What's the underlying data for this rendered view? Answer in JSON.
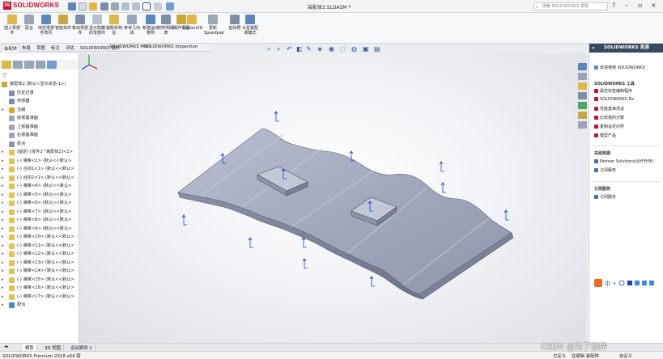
{
  "app": {
    "logo_text": "SOLIDWORKS",
    "document_title": "装配体2.SLDASM *",
    "search_placeholder": "搜索 SOLIDWORKS 帮助"
  },
  "ribbon": {
    "buttons": [
      {
        "label": "插入零部件",
        "icon": "insert-component-icon"
      },
      {
        "label": "配合",
        "icon": "mate-icon"
      },
      {
        "label": "线性零部件阵列",
        "icon": "linear-pattern-icon"
      },
      {
        "label": "智能扣件",
        "icon": "smart-fastener-icon"
      },
      {
        "label": "移动零部件",
        "icon": "move-component-icon"
      },
      {
        "label": "显示隐藏的零部件",
        "icon": "show-hidden-icon"
      },
      {
        "label": "装配体特征",
        "icon": "assembly-feature-icon"
      },
      {
        "label": "参考几何体",
        "icon": "reference-geometry-icon"
      },
      {
        "label": "新建运动算例",
        "icon": "motion-study-icon"
      },
      {
        "label": "材料明细表",
        "icon": "bom-icon"
      },
      {
        "label": "爆炸视图",
        "icon": "exploded-view-icon"
      },
      {
        "label": "Instant3D",
        "icon": "instant3d-icon"
      },
      {
        "label": "更新Speedpak",
        "icon": "speedpak-icon"
      },
      {
        "label": "拍快照",
        "icon": "snapshot-icon"
      },
      {
        "label": "大型装配体模式",
        "icon": "large-assembly-icon"
      }
    ]
  },
  "command_tabs": [
    "装配体",
    "布局",
    "草图",
    "标注",
    "评估",
    "SOLIDWORKS 插件",
    "SOLIDWORKS MBD",
    "SOLIDWORKS Inspection"
  ],
  "feature_tree": {
    "items": [
      {
        "label": "装配体2 (默认<显示状态-1>)",
        "icon_color": "#c8a640",
        "arrow": ""
      },
      {
        "label": "历史记录",
        "icon_color": "#7d8fa8",
        "arrow": ""
      },
      {
        "label": "传感器",
        "icon_color": "#7d8fa8",
        "arrow": ""
      },
      {
        "label": "注解",
        "icon_color": "#e0a020",
        "arrow": "▸"
      },
      {
        "label": "前视基准面",
        "icon_color": "#9aa6b8",
        "arrow": ""
      },
      {
        "label": "上视基准面",
        "icon_color": "#9aa6b8",
        "arrow": ""
      },
      {
        "label": "右视基准面",
        "icon_color": "#9aa6b8",
        "arrow": ""
      },
      {
        "label": "原点",
        "icon_color": "#8a96a8",
        "arrow": ""
      },
      {
        "label": "(固定) [零件1^装配体2]<1>",
        "icon_color": "#e4c34a",
        "arrow": "▸"
      },
      {
        "label": "(-) 弹簧<1> (默认<<默认>",
        "icon_color": "#e4c34a",
        "arrow": "▸"
      },
      {
        "label": "(-) 合扣1<1> (默认<<默认>",
        "icon_color": "#e4c34a",
        "arrow": "▸"
      },
      {
        "label": "(-) 合扣2<1> (默认<<默认>",
        "icon_color": "#e4c34a",
        "arrow": "▸"
      },
      {
        "label": "(-) 弹簧<4> (默认<<默认>",
        "icon_color": "#e4c34a",
        "arrow": "▸"
      },
      {
        "label": "(-) 弹簧<5> (默认<<默认>",
        "icon_color": "#e4c34a",
        "arrow": "▸"
      },
      {
        "label": "(-) 弹簧<6> (默认<<默认>",
        "icon_color": "#e4c34a",
        "arrow": "▸"
      },
      {
        "label": "(-) 弹簧<7> (默认<<默认>",
        "icon_color": "#e4c34a",
        "arrow": "▸"
      },
      {
        "label": "(-) 弹簧<8> (默认<<默认>",
        "icon_color": "#e4c34a",
        "arrow": "▸"
      },
      {
        "label": "(-) 弹簧<9> (默认<<默认>",
        "icon_color": "#e4c34a",
        "arrow": "▸"
      },
      {
        "label": "(-) 弹簧<10> (默认<<默认>",
        "icon_color": "#e4c34a",
        "arrow": "▸"
      },
      {
        "label": "(-) 弹簧<11> (默认<<默认>",
        "icon_color": "#e4c34a",
        "arrow": "▸"
      },
      {
        "label": "(-) 弹簧<12> (默认<<默认>",
        "icon_color": "#e4c34a",
        "arrow": "▸"
      },
      {
        "label": "(-) 弹簧<13> (默认<<默认>",
        "icon_color": "#e4c34a",
        "arrow": "▸"
      },
      {
        "label": "(-) 弹簧<14> (默认<<默认>",
        "icon_color": "#e4c34a",
        "arrow": "▸"
      },
      {
        "label": "(-) 弹簧<15> (默认<<默认>",
        "icon_color": "#e4c34a",
        "arrow": "▸"
      },
      {
        "label": "(-) 弹簧<16> (默认<<默认>",
        "icon_color": "#e4c34a",
        "arrow": "▸"
      },
      {
        "label": "(-) 弹簧<17> (默认<<默认>",
        "icon_color": "#e4c34a",
        "arrow": "▸"
      },
      {
        "label": "配合",
        "icon_color": "#4a8ac8",
        "arrow": "▸"
      }
    ]
  },
  "task_pane": {
    "title": "SOLIDWORKS 资源",
    "welcome": "欢迎使用 SOLIDWORKS",
    "tools_header": "SOLIDWORKS 工具",
    "tools": [
      {
        "label": "属性标签编制程序",
        "color": "#c8102e"
      },
      {
        "label": "SOLIDWORKS Rx",
        "color": "#c8102e"
      },
      {
        "label": "性能基准测试",
        "color": "#c8102e"
      },
      {
        "label": "比较我的分数",
        "color": "#c8102e"
      },
      {
        "label": "复制设定向导",
        "color": "#c8102e"
      },
      {
        "label": "模型产品",
        "color": "#c8102e"
      }
    ],
    "online_header": "在线资源",
    "online": [
      {
        "label": "Partner Solutions(合作伙伴)",
        "color": "#4a6ea8"
      },
      {
        "label": "订阅服务",
        "color": "#4a6ea8"
      }
    ],
    "sub_header": "订阅服务",
    "sub": [
      {
        "label": "订阅服务",
        "color": "#4a6ea8"
      }
    ]
  },
  "bottom_tabs": [
    "模型",
    "3D 视图",
    "运动算例 1"
  ],
  "status": {
    "product": "SOLIDWORKS Premium 2018 x64 版",
    "state": "欠定义",
    "mode": "在编辑 装配体",
    "units": "自定义"
  },
  "watermark": "CSDN @为了彼岸",
  "colors": {
    "accent": "#c8102e",
    "part_face": "#9aa0b4",
    "axis_blue": "#1f3fd0",
    "panel_header": "#3a4a5e"
  }
}
